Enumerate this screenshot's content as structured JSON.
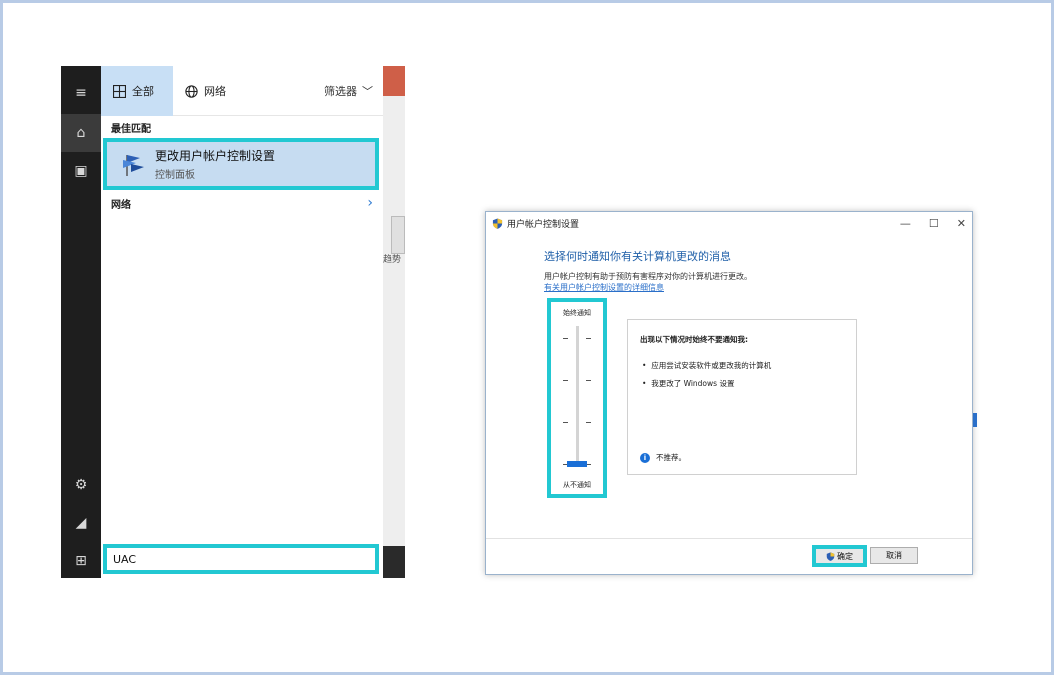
{
  "search_panel": {
    "tabs": [
      {
        "label": "全部",
        "icon": "grid-icon"
      },
      {
        "label": "网络",
        "icon": "globe-icon"
      }
    ],
    "filter_label": "筛选器",
    "best_match_heading": "最佳匹配",
    "best_result": {
      "title": "更改用户帐户控制设置",
      "subtitle": "控制面板",
      "icon": "uac-flag-icon"
    },
    "web_row_label": "网络",
    "search_query": "UAC",
    "desktop_label": "趋势"
  },
  "uac_dialog": {
    "title": "用户帐户控制设置",
    "window_controls": [
      "—",
      "☐",
      "✕"
    ],
    "heading": "选择何时通知你有关计算机更改的消息",
    "description": "用户帐户控制有助于预防有害程序对你的计算机进行更改。",
    "link": "有关用户帐户控制设置的详细信息",
    "slider": {
      "top_label": "始终通知",
      "bottom_label": "从不通知",
      "level": 0,
      "levels": 4
    },
    "info": {
      "heading": "出现以下情况时始终不要通知我:",
      "bullets": [
        "应用尝试安装软件或更改我的计算机",
        "我更改了 Windows 设置"
      ],
      "note": "不推荐。"
    },
    "ok_label": "确定",
    "cancel_label": "取消"
  },
  "colors": {
    "highlight": "#22c8d2",
    "accent": "#1a6fd6",
    "rail": "#1e1e1e"
  }
}
